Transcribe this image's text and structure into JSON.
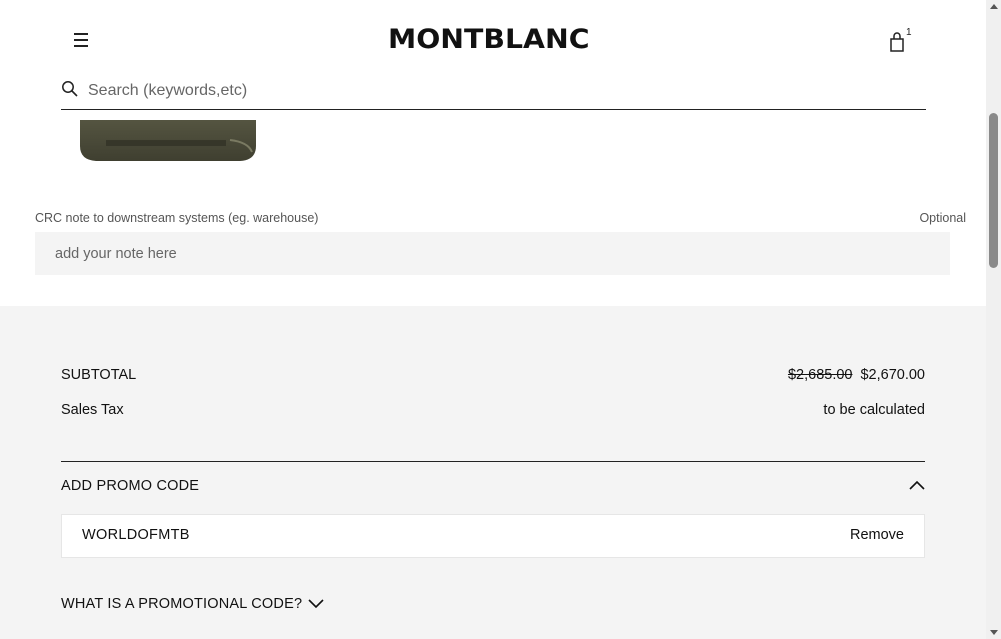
{
  "header": {
    "logo_text": "MONTBLANC",
    "bag_count": "1",
    "search_placeholder": "Search (keywords,etc)"
  },
  "note": {
    "label": "CRC note to downstream systems (eg. warehouse)",
    "optional": "Optional",
    "placeholder": "add your note here"
  },
  "summary": {
    "subtotal_label": "SUBTOTAL",
    "subtotal_original": "$2,685.00",
    "subtotal_value": "$2,670.00",
    "tax_label": "Sales Tax",
    "tax_value": "to be calculated"
  },
  "promo": {
    "heading": "ADD PROMO CODE",
    "code": "WORLDOFMTB",
    "remove_label": "Remove",
    "info_link": "WHAT IS A PROMOTIONAL CODE?"
  },
  "colors": {
    "text": "#111111",
    "summary_bg": "#f4f4f4",
    "field_bg": "#f4f4f4"
  }
}
